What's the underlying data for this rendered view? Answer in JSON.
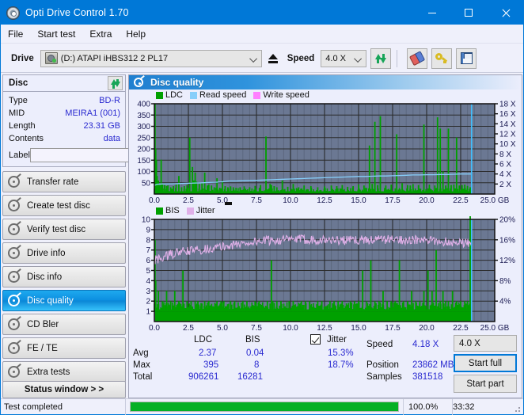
{
  "window": {
    "title": "Opti Drive Control 1.70",
    "icon": "disc-icon",
    "minimize": "minimize",
    "maximize": "maximize",
    "close": "close"
  },
  "menu": {
    "items": [
      "File",
      "Start test",
      "Extra",
      "Help"
    ]
  },
  "toolbar": {
    "drive_label": "Drive",
    "drive_value": "(D:)   ATAPI iHBS312   2 PL17",
    "eject": "eject",
    "speed_label": "Speed",
    "speed_value": "4.0 X",
    "refresh": "refresh",
    "erase": "erase",
    "key": "key",
    "save": "save"
  },
  "disc_panel": {
    "title": "Disc",
    "refresh_button": "refresh",
    "rows": [
      {
        "key": "Type",
        "value": "BD-R"
      },
      {
        "key": "MID",
        "value": "MEIRA1 (001)"
      },
      {
        "key": "Length",
        "value": "23.31 GB"
      },
      {
        "key": "Contents",
        "value": "data"
      }
    ],
    "label_key": "Label",
    "label_value": "",
    "label_placeholder": ""
  },
  "nav": {
    "items": [
      {
        "label": "Transfer rate",
        "active": false
      },
      {
        "label": "Create test disc",
        "active": false
      },
      {
        "label": "Verify test disc",
        "active": false
      },
      {
        "label": "Drive info",
        "active": false
      },
      {
        "label": "Disc info",
        "active": false
      },
      {
        "label": "Disc quality",
        "active": true
      },
      {
        "label": "CD Bler",
        "active": false
      },
      {
        "label": "FE / TE",
        "active": false
      },
      {
        "label": "Extra tests",
        "active": false
      }
    ],
    "status_window": "Status window > >"
  },
  "panel": {
    "title": "Disc quality"
  },
  "stats": {
    "col_headers": [
      "LDC",
      "BIS"
    ],
    "row_labels": [
      "Avg",
      "Max",
      "Total"
    ],
    "ldc": {
      "avg": "2.37",
      "max": "395",
      "total": "906261"
    },
    "bis": {
      "avg": "0.04",
      "max": "8",
      "total": "16281"
    },
    "jitter_label": "Jitter",
    "jitter_checked": true,
    "jitter_avg": "15.3%",
    "jitter_max": "18.7%",
    "speed_label": "Speed",
    "speed_value": "4.18 X",
    "position_label": "Position",
    "position_value": "23862 MB",
    "samples_label": "Samples",
    "samples_value": "381518",
    "speed_select": "4.0 X",
    "start_full": "Start full",
    "start_part": "Start part"
  },
  "statusbar": {
    "message": "Test completed",
    "percent": "100.0%",
    "progress": 100,
    "elapsed": "33:32"
  },
  "colors": {
    "accent": "#0078d7",
    "ldc": "#00a000",
    "bis": "#00a000",
    "read_speed": "#87cefa",
    "write_speed": "#ff80ff",
    "jitter": "#e0b0e8",
    "plot_bg": "#6b7893",
    "value_text": "#2a2ad0",
    "progress": "#06b025"
  },
  "chart_data": [
    {
      "type": "line",
      "id": "ldc-chart",
      "title": "Disc quality - LDC / Read speed",
      "legend": [
        {
          "label": "LDC",
          "color": "#00a000"
        },
        {
          "label": "Read speed",
          "color": "#87cefa"
        },
        {
          "label": "Write speed",
          "color": "#ff80ff"
        }
      ],
      "legend_position": "top-left",
      "xlabel": "GB",
      "xlim": [
        0,
        25.0
      ],
      "xticks": [
        "0.0",
        "2.5",
        "5.0",
        "7.5",
        "10.0",
        "12.5",
        "15.0",
        "17.5",
        "20.0",
        "22.5",
        "25.0 GB"
      ],
      "ylabel_left": "LDC",
      "ylim": [
        0,
        400
      ],
      "yticks": [
        50,
        100,
        150,
        200,
        250,
        300,
        350,
        400
      ],
      "ylabel_right": "Speed",
      "y2lim": [
        0,
        18
      ],
      "y2ticks": [
        "2 X",
        "4 X",
        "6 X",
        "8 X",
        "10 X",
        "12 X",
        "14 X",
        "16 X",
        "18 X"
      ],
      "grid": true,
      "series": [
        {
          "name": "LDC",
          "type": "impulse",
          "color": "#00a000",
          "x": [
            0.05,
            0.1,
            0.15,
            0.2,
            0.3,
            0.4,
            0.5,
            0.6,
            0.75,
            0.9,
            1.0,
            1.2,
            1.4,
            1.6,
            1.8,
            2.0,
            2.2,
            2.4,
            2.6,
            2.8,
            2.9,
            3.0,
            3.1,
            3.3,
            3.5,
            3.7,
            3.9,
            4.0,
            4.2,
            4.4,
            4.6,
            4.8,
            5.0,
            5.2,
            5.4,
            5.6,
            5.8,
            6.0,
            6.3,
            6.6,
            7.0,
            7.4,
            7.8,
            8.2,
            8.5,
            8.6,
            8.8,
            9.0,
            9.4,
            9.8,
            10.2,
            10.6,
            11.0,
            11.5,
            12.0,
            12.5,
            13.0,
            13.4,
            13.8,
            14.2,
            14.6,
            15.0,
            15.4,
            15.8,
            16.0,
            16.2,
            16.4,
            16.6,
            17.0,
            17.4,
            17.8,
            18.2,
            18.6,
            18.8,
            19.0,
            19.4,
            19.8,
            20.2,
            20.6,
            20.8,
            21.0,
            21.2,
            21.4,
            21.6,
            21.8,
            22.0,
            22.2,
            22.4,
            22.6,
            22.8,
            23.0,
            23.2
          ],
          "y": [
            400,
            200,
            150,
            80,
            60,
            40,
            152,
            45,
            40,
            35,
            38,
            30,
            35,
            42,
            80,
            30,
            35,
            40,
            250,
            120,
            60,
            95,
            55,
            45,
            50,
            95,
            38,
            42,
            38,
            30,
            70,
            28,
            58,
            35,
            30,
            34,
            30,
            28,
            30,
            34,
            30,
            36,
            40,
            255,
            45,
            40,
            35,
            30,
            60,
            32,
            45,
            30,
            38,
            35,
            30,
            34,
            38,
            35,
            40,
            32,
            35,
            42,
            38,
            215,
            45,
            320,
            40,
            345,
            38,
            42,
            265,
            48,
            40,
            38,
            44,
            40,
            308,
            42,
            38,
            340,
            290,
            100,
            38,
            290,
            40,
            42,
            250,
            38,
            40,
            42,
            36,
            30
          ]
        },
        {
          "name": "Read speed",
          "type": "line",
          "color": "#87cefa",
          "axis": "right",
          "x": [
            0.0,
            0.2,
            0.5,
            1.0,
            1.5,
            2.0,
            2.5,
            3.0,
            3.5,
            4.0,
            4.5,
            5.0,
            5.5,
            6.0,
            6.5,
            7.0,
            7.5,
            8.0,
            8.5,
            9.0,
            9.5,
            10.0,
            10.5,
            11.0,
            11.5,
            12.0,
            12.5,
            13.0,
            13.5,
            14.0,
            14.5,
            15.0,
            15.5,
            16.0,
            16.5,
            17.0,
            17.5,
            18.0,
            18.5,
            19.0,
            19.5,
            20.0,
            20.5,
            21.0,
            21.5,
            22.0,
            22.5,
            23.3
          ],
          "y": [
            1.7,
            1.95,
            2.0,
            2.02,
            2.05,
            2.1,
            2.15,
            2.2,
            2.25,
            2.3,
            2.35,
            2.45,
            2.6,
            2.6,
            2.65,
            2.7,
            2.75,
            2.8,
            2.85,
            2.9,
            2.95,
            3.0,
            3.05,
            3.1,
            3.15,
            3.2,
            3.25,
            3.3,
            3.35,
            3.4,
            3.45,
            3.5,
            3.5,
            3.55,
            3.6,
            3.6,
            3.65,
            3.7,
            3.75,
            3.8,
            3.8,
            3.85,
            3.85,
            3.9,
            3.9,
            3.95,
            4.0,
            4.0
          ]
        },
        {
          "name": "Write speed",
          "type": "line",
          "color": "#ff80ff",
          "x": [],
          "y": []
        },
        {
          "name": "End marker",
          "type": "vline",
          "color": "#40c0ff",
          "x": [
            23.3
          ]
        }
      ]
    },
    {
      "type": "line",
      "id": "bis-chart",
      "title": "Disc quality - BIS / Jitter",
      "legend": [
        {
          "label": "BIS",
          "color": "#00a000"
        },
        {
          "label": "Jitter",
          "color": "#e0b0e8"
        }
      ],
      "legend_position": "top-left",
      "xlabel": "GB",
      "xlim": [
        0,
        25.0
      ],
      "xticks": [
        "0.0",
        "2.5",
        "5.0",
        "7.5",
        "10.0",
        "12.5",
        "15.0",
        "17.5",
        "20.0",
        "22.5",
        "25.0 GB"
      ],
      "ylabel_left": "BIS",
      "ylim": [
        0,
        10
      ],
      "yticks": [
        1,
        2,
        3,
        4,
        5,
        6,
        7,
        8,
        9,
        10
      ],
      "ylabel_right": "Jitter",
      "y2lim": [
        0,
        20
      ],
      "y2ticks": [
        "4%",
        "8%",
        "12%",
        "16%",
        "20%"
      ],
      "grid": true,
      "series": [
        {
          "name": "BIS",
          "type": "impulse",
          "color": "#00a000",
          "baseline": 1,
          "x": [
            0.05,
            0.1,
            0.3,
            0.6,
            0.9,
            1.2,
            1.5,
            1.8,
            2.1,
            2.4,
            2.7,
            3.0,
            3.2,
            3.4,
            3.7,
            4.0,
            4.3,
            4.6,
            4.9,
            5.1,
            5.3,
            5.6,
            5.9,
            6.2,
            6.5,
            6.8,
            7.1,
            7.4,
            7.7,
            8.0,
            8.3,
            8.6,
            8.7,
            9.0,
            9.3,
            9.6,
            9.9,
            10.2,
            10.5,
            10.8,
            11.1,
            11.4,
            11.7,
            12.0,
            12.3,
            12.6,
            12.9,
            13.2,
            13.5,
            13.8,
            14.1,
            14.4,
            14.7,
            15.0,
            15.3,
            15.6,
            15.9,
            16.2,
            16.5,
            16.8,
            17.1,
            17.4,
            17.7,
            18.0,
            18.3,
            18.6,
            18.9,
            19.2,
            19.5,
            19.8,
            20.1,
            20.4,
            20.7,
            21.0,
            21.2,
            21.4,
            21.6,
            21.9,
            22.2,
            22.5,
            22.8,
            23.0,
            23.2
          ],
          "y": [
            8,
            4,
            3,
            2,
            3,
            2,
            3,
            2,
            5,
            2,
            2,
            2,
            2,
            1.5,
            2,
            2,
            1.5,
            2,
            2,
            2,
            1.5,
            2,
            2,
            1.5,
            2,
            2,
            1.5,
            2,
            2,
            1.5,
            2,
            6,
            2,
            2,
            2,
            1.5,
            2,
            2,
            1.5,
            2,
            2,
            2,
            1.5,
            2,
            2,
            1.5,
            2,
            2,
            2,
            2,
            1.5,
            2,
            2,
            2,
            5,
            2,
            6,
            2,
            2,
            3,
            2,
            2,
            2,
            6,
            2,
            2,
            3,
            2,
            2,
            3,
            5,
            3,
            7,
            2,
            3,
            2,
            2,
            3,
            2,
            2,
            2,
            2
          ]
        },
        {
          "name": "Jitter",
          "type": "noisy-line",
          "color": "#e0b0e8",
          "axis": "right",
          "x_start": 0.05,
          "x_end": 23.3,
          "trend": [
            12.0,
            13.5,
            14.0,
            14.5,
            15.2,
            15.8,
            16.0,
            16.1,
            16.0,
            15.9,
            16.0,
            16.1,
            16.0,
            15.8,
            15.6,
            15.4
          ],
          "noise_amp": 0.9
        },
        {
          "name": "End marker",
          "type": "vline",
          "color": "#40c0ff",
          "x": [
            23.3
          ]
        }
      ]
    }
  ]
}
